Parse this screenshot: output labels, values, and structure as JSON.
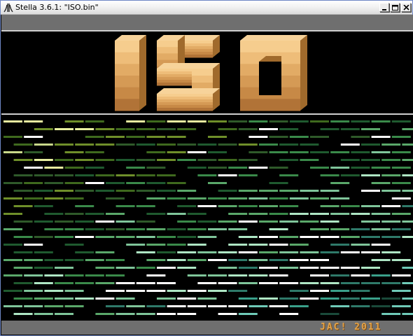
{
  "window": {
    "title": "Stella 3.6.1: \"ISO.bin\"",
    "icon": "atari-fuji-icon",
    "controls": [
      "minimize-icon",
      "maximize-icon",
      "close-icon"
    ]
  },
  "logo": {
    "text": "ISO",
    "colors": {
      "front_light": "#f4c784",
      "front_mid": "#d9a35e",
      "front_dark": "#b97c3c",
      "side": "#a06a2c",
      "top": "#f7d39a"
    }
  },
  "credit": {
    "text": "JAC! 2011",
    "color": "#e3a349"
  },
  "colors": {
    "background": "#000000",
    "strip": "#6f6f6f",
    "separator": "#cfcfcf"
  }
}
